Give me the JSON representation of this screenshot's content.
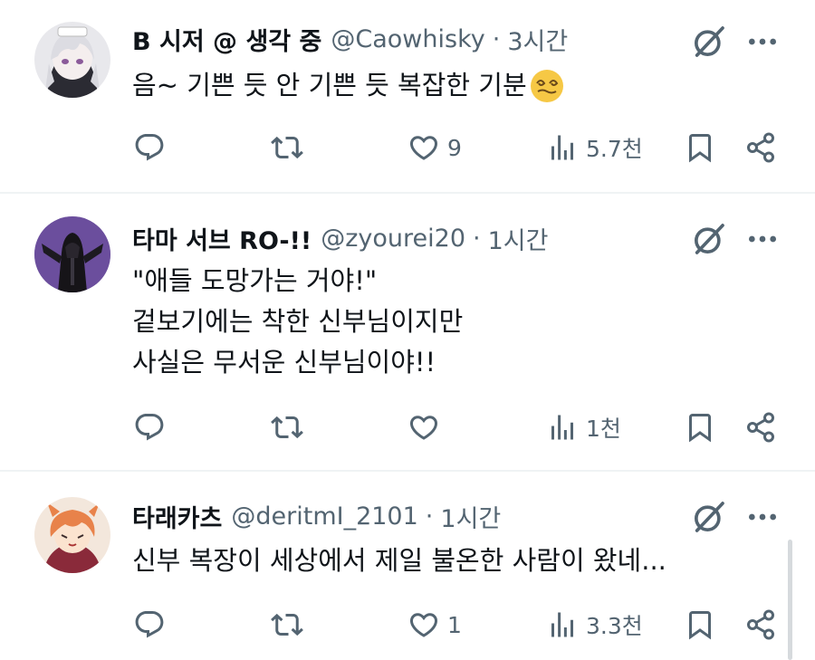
{
  "tweets": [
    {
      "name": "B 시저 @ 생각 중",
      "handle": "@Caowhisky",
      "separator": "·",
      "time": "3시간",
      "lines": [
        "음~ 기쁜 듯 안 기쁜 듯 복잡한 기분"
      ],
      "emoji": "dizzy-face-emoji",
      "avatar": "anime-white-haired-character",
      "reply_count": "",
      "retweet_count": "",
      "like_count": "9",
      "view_count": "5.7천"
    },
    {
      "name": "타마 서브 RO-!!",
      "handle": "@zyourei20",
      "separator": "·",
      "time": "1시간",
      "lines": [
        "\"애들 도망가는 거야!\"",
        "겉보기에는 착한 신부님이지만",
        "사실은 무서운 신부님이야!!"
      ],
      "avatar": "dark-cloaked-priest-figure",
      "reply_count": "",
      "retweet_count": "",
      "like_count": "",
      "view_count": "1천"
    },
    {
      "name": "타래카츠",
      "handle": "@deritmI_2101",
      "separator": "·",
      "time": "1시간",
      "lines": [
        "신부 복장이 세상에서 제일 불온한 사람이 왔네..."
      ],
      "avatar": "orange-haired-anime-character",
      "reply_count": "",
      "retweet_count": "",
      "like_count": "1",
      "view_count": "3.3천"
    }
  ],
  "icons": {
    "reply": "reply-icon",
    "retweet": "retweet-icon",
    "like": "like-icon",
    "views": "views-icon",
    "bookmark": "bookmark-icon",
    "share": "share-icon",
    "grok": "grok-icon",
    "more": "more-icon"
  },
  "colors": {
    "text": "#0f1419",
    "secondary": "#536471",
    "divider": "#eff3f4",
    "emoji": "#f6c845"
  }
}
